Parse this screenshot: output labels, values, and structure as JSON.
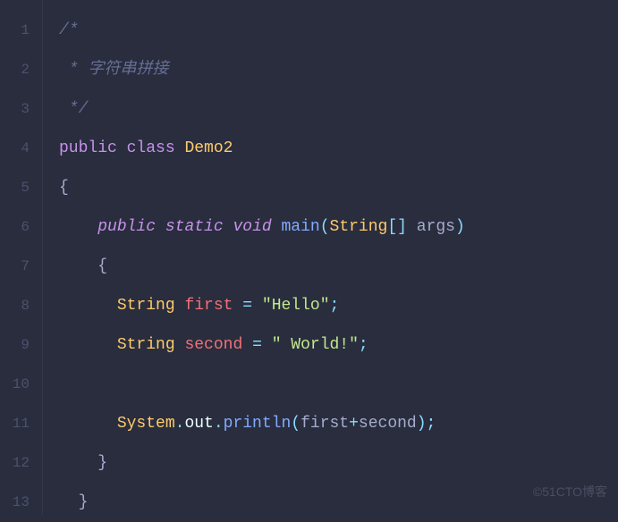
{
  "line_numbers": [
    "1",
    "2",
    "3",
    "4",
    "5",
    "6",
    "7",
    "8",
    "9",
    "10",
    "11",
    "12",
    "13"
  ],
  "code": {
    "l1": {
      "c1": "/*"
    },
    "l2": {
      "c1": " * 字符串拼接"
    },
    "l3": {
      "c1": " */"
    },
    "l4": {
      "kw_public": "public",
      "kw_class": "class",
      "classname": "Demo2"
    },
    "l5": {
      "brace": "{"
    },
    "l6": {
      "kw_public": "public",
      "kw_static": "static",
      "kw_void": "void",
      "fn": "main",
      "lp": "(",
      "type": "String",
      "lb": "[",
      "rb": "]",
      "arg": "args",
      "rp": ")"
    },
    "l7": {
      "brace": "{"
    },
    "l8": {
      "type": "String",
      "var": "first",
      "op": "=",
      "str": "\"Hello\"",
      "semi": ";"
    },
    "l9": {
      "type": "String",
      "var": "second",
      "op": "=",
      "str": "\" World!\"",
      "semi": ";"
    },
    "l10": {},
    "l11": {
      "sys": "System",
      "dot1": ".",
      "out": "out",
      "dot2": ".",
      "fn": "println",
      "lp": "(",
      "a1": "first",
      "plus": "+",
      "a2": "second",
      "rp": ")",
      "semi": ";"
    },
    "l12": {
      "brace": "}"
    },
    "l13": {
      "brace": "}"
    }
  },
  "watermark": "©51CTO博客"
}
